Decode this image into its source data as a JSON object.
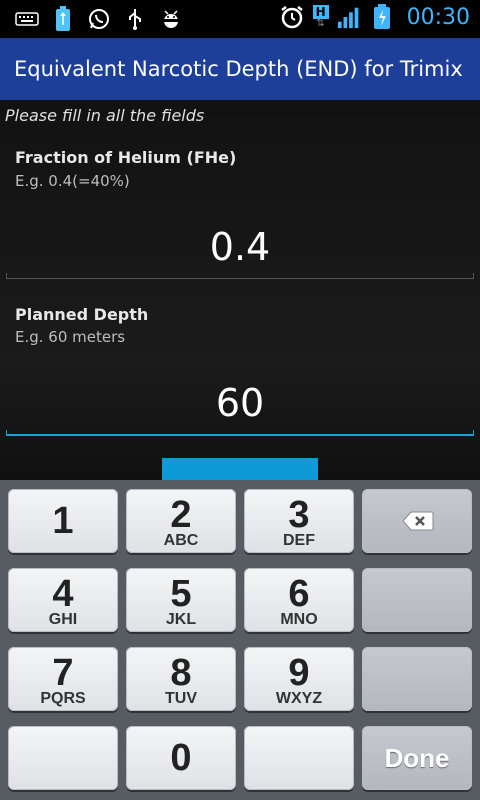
{
  "status_bar": {
    "icons_left": [
      "keyboard-icon",
      "usb-battery-icon",
      "whatsapp-icon",
      "usb-icon",
      "android-debug-icon"
    ],
    "icons_right": [
      "alarm-icon",
      "hspa-data-icon",
      "signal-icon",
      "battery-charging-icon"
    ],
    "time": "00:30",
    "network_label": "H"
  },
  "titlebar": {
    "title": "Equivalent Narcotic Depth (END) for Trimix"
  },
  "form": {
    "hint": "Please fill in all the fields",
    "fields": [
      {
        "label": "Fraction of Helium (FHe)",
        "example": "E.g. 0.4(=40%)",
        "value": "0.4"
      },
      {
        "label": "Planned Depth",
        "example": "E.g. 60 meters",
        "value": "60"
      }
    ],
    "accent_color": "#1aa0d8"
  },
  "keypad": {
    "keys": [
      {
        "num": "1",
        "letters": ""
      },
      {
        "num": "2",
        "letters": "ABC"
      },
      {
        "num": "3",
        "letters": "DEF"
      },
      {
        "num": "4",
        "letters": "GHI"
      },
      {
        "num": "5",
        "letters": "JKL"
      },
      {
        "num": "6",
        "letters": "MNO"
      },
      {
        "num": "7",
        "letters": "PQRS"
      },
      {
        "num": "8",
        "letters": "TUV"
      },
      {
        "num": "9",
        "letters": "WXYZ"
      },
      {
        "num": "0",
        "letters": ""
      }
    ],
    "done_label": "Done",
    "backspace_icon": "backspace-icon"
  }
}
